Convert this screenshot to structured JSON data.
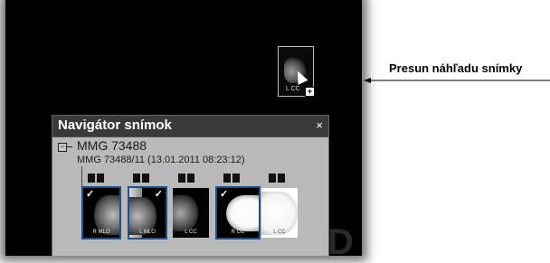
{
  "annotation": {
    "text": "Presun náhľadu snímky"
  },
  "drag_preview": {
    "label": "L CC",
    "badge": "+"
  },
  "navigator": {
    "title": "Navigátor snímok",
    "close": "×",
    "tree_toggle": "−",
    "study": "MMG 73488",
    "series": "MMG 73488/11 (13.01.2011 08:23:12)",
    "images": [
      {
        "label": "R MLO",
        "checked": "✓"
      },
      {
        "label": "L MLO",
        "checked": "✓"
      },
      {
        "label": "L CC",
        "checked": ""
      },
      {
        "label": "R CC",
        "checked": "✓"
      },
      {
        "label": "L CC",
        "checked": ""
      }
    ]
  }
}
